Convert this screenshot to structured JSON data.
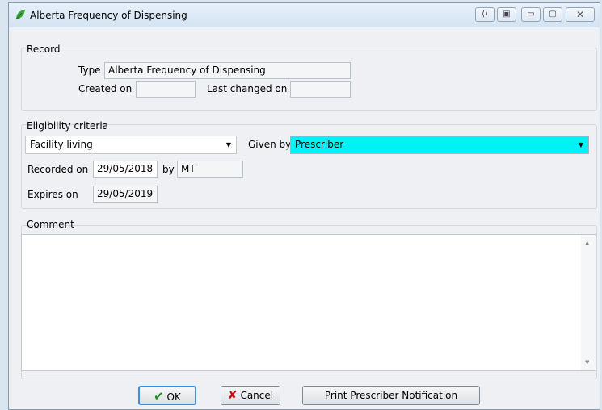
{
  "window": {
    "title": "Alberta Frequency of Dispensing",
    "buttons": {
      "close": "☒"
    }
  },
  "record": {
    "group_label": "Record",
    "type_label": "Type",
    "type_value": "Alberta Frequency of Dispensing",
    "created_label": "Created on",
    "created_value": "",
    "changed_label": "Last changed on",
    "changed_value": ""
  },
  "eligibility": {
    "group_label": "Eligibility criteria",
    "criteria_value": "Facility living",
    "given_by_label": "Given by",
    "given_by_value": "Prescriber",
    "recorded_label": "Recorded on",
    "recorded_value": "29/05/2018",
    "by_label": "by",
    "by_value": "MT",
    "expires_label": "Expires on",
    "expires_value": "29/05/2019"
  },
  "comment": {
    "group_label": "Comment",
    "value": ""
  },
  "footer": {
    "ok_label": "OK",
    "cancel_label": "Cancel",
    "print_label": "Print Prescriber Notification"
  },
  "colors": {
    "given_by_bg": "#00f3f3",
    "ok_border": "#3d8ee0"
  },
  "icons": [
    "leaf-icon",
    "chevron-down-icon",
    "check-icon",
    "x-icon",
    "minimize-icon",
    "restore-icon",
    "close-icon"
  ]
}
